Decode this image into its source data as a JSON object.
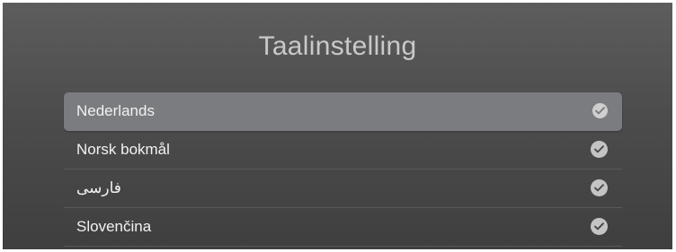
{
  "screen": {
    "title": "Taalinstelling"
  },
  "languages": [
    {
      "label": "Nederlands",
      "selected": true,
      "icon": "check-circle-icon"
    },
    {
      "label": "Norsk bokmål",
      "selected": false,
      "icon": "check-circle-icon"
    },
    {
      "label": "فارسی",
      "selected": false,
      "icon": "check-circle-icon"
    },
    {
      "label": "Slovenčina",
      "selected": false,
      "icon": "check-circle-icon"
    }
  ],
  "colors": {
    "background_top": "#5d5d5d",
    "background_bottom": "#3f3f3f",
    "selected_row": "#7b7c7f",
    "check_fill": "#c4c4c4"
  }
}
